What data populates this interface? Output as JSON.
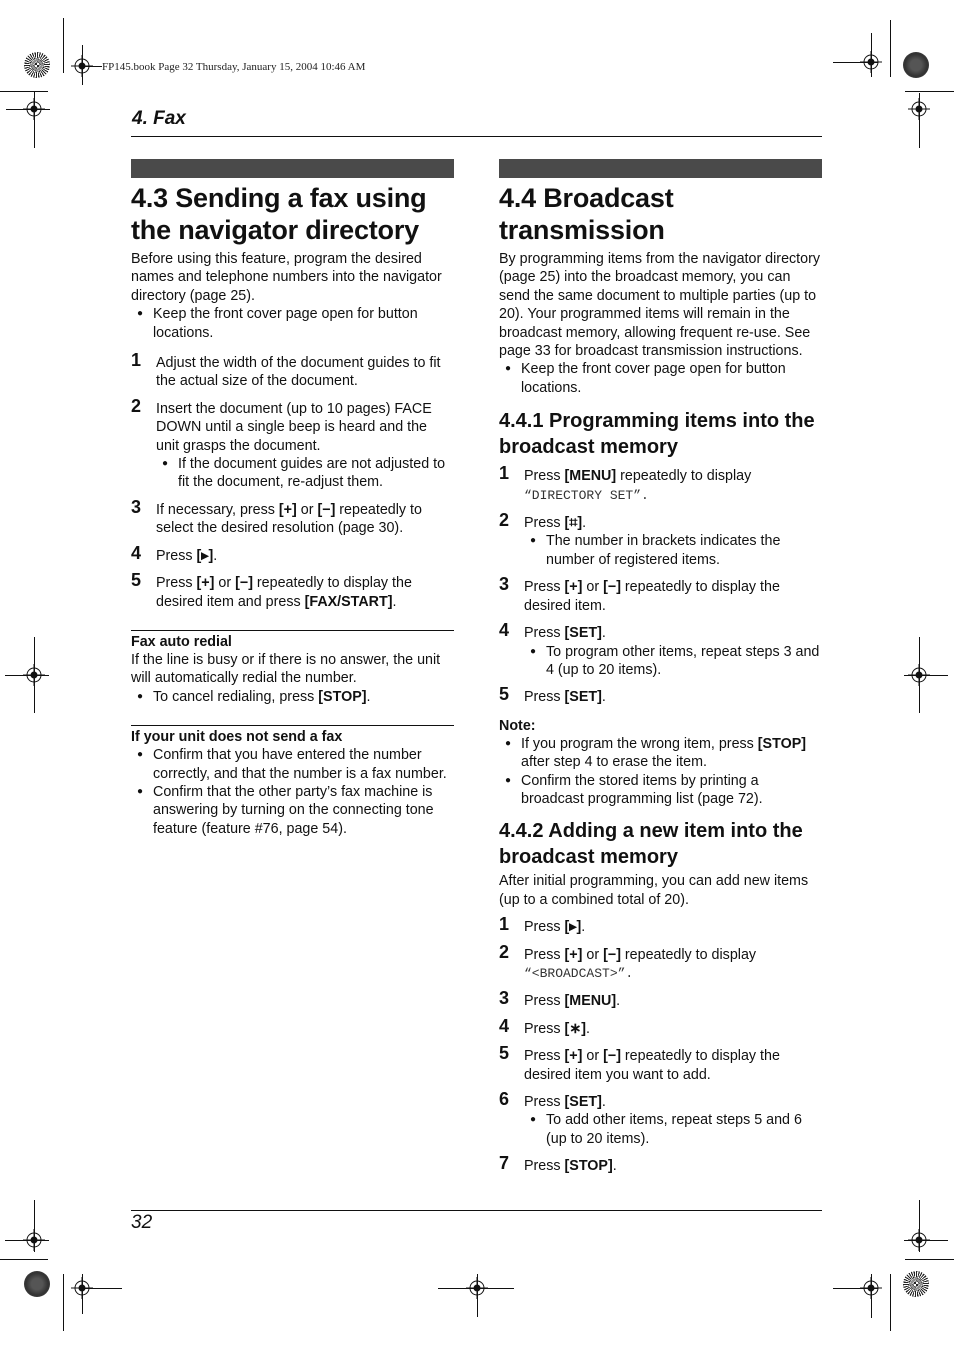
{
  "header": {
    "book_line": "FP145.book  Page 32  Thursday, January 15, 2004  10:46 AM",
    "chapter": "4. Fax"
  },
  "left": {
    "title": "4.3 Sending a fax using the navigator directory",
    "intro": "Before using this feature, program the desired names and telephone numbers into the navigator directory (page 25).",
    "intro_bullet": "Keep the front cover page open for button locations.",
    "steps": [
      {
        "num": "1",
        "text": "Adjust the width of the document guides to fit the actual size of the document."
      },
      {
        "num": "2",
        "text": "Insert the document (up to 10 pages) FACE DOWN until a single beep is heard and the unit grasps the document.",
        "bullet": "If the document guides are not adjusted to fit the document, re-adjust them."
      },
      {
        "num": "3",
        "pre": "If necessary, press ",
        "k1": "[+]",
        "mid": " or ",
        "k2": "[−]",
        "post": " repeatedly to select the desired resolution (page 30)."
      },
      {
        "num": "4",
        "pre": "Press ",
        "k1": "[▸]",
        "post": "."
      },
      {
        "num": "5",
        "pre": "Press ",
        "k1": "[+]",
        "mid": " or ",
        "k2": "[−]",
        "mid2": " repeatedly to display the desired item and press ",
        "k3": "[FAX/START]",
        "post": "."
      }
    ],
    "redial": {
      "heading": "Fax auto redial",
      "text": "If the line is busy or if there is no answer, the unit will automatically redial the number.",
      "bullet_pre": "To cancel redialing, press ",
      "bullet_key": "[STOP]",
      "bullet_post": "."
    },
    "nosend": {
      "heading": "If your unit does not send a fax",
      "bullets": [
        "Confirm that you have entered the number correctly, and that the number is a fax number.",
        "Confirm that the other party’s fax machine is answering by turning on the connecting tone feature (feature #76, page 54)."
      ]
    }
  },
  "right": {
    "title": "4.4 Broadcast transmission",
    "intro": "By programming items from the navigator directory (page 25) into the broadcast memory, you can send the same document to multiple parties (up to 20). Your programmed items will remain in the broadcast memory, allowing frequent re-use. See page 33 for broadcast transmission instructions.",
    "intro_bullet": "Keep the front cover page open for button locations.",
    "sec1": {
      "title": "4.4.1 Programming items into the broadcast memory",
      "s1_pre": "Press ",
      "s1_key": "[MENU]",
      "s1_post": " repeatedly to display",
      "s1_display": "“DIRECTORY SET”.",
      "s2_pre": "Press ",
      "s2_key": "[⌗]",
      "s2_post": ".",
      "s2_bullet": "The number in brackets indicates the number of registered items.",
      "s3_pre": "Press ",
      "s3_k1": "[+]",
      "s3_mid": " or ",
      "s3_k2": "[−]",
      "s3_post": " repeatedly to display the desired item.",
      "s4_pre": "Press ",
      "s4_key": "[SET]",
      "s4_post": ".",
      "s4_bullet": "To program other items, repeat steps 3 and 4 (up to 20 items).",
      "s5_pre": "Press ",
      "s5_key": "[SET]",
      "s5_post": ".",
      "note_label": "Note:",
      "note1_pre": "If you program the wrong item, press ",
      "note1_key": "[STOP]",
      "note1_post": " after step 4 to erase the item.",
      "note2": "Confirm the stored items by printing a broadcast programming list (page 72)."
    },
    "sec2": {
      "title": "4.4.2 Adding a new item into the broadcast memory",
      "intro": "After initial programming, you can add new items (up to a combined total of 20).",
      "s1_pre": "Press ",
      "s1_key": "[▸]",
      "s1_post": ".",
      "s2_pre": "Press ",
      "s2_k1": "[+]",
      "s2_mid": " or ",
      "s2_k2": "[−]",
      "s2_post": " repeatedly to display",
      "s2_display": "“<BROADCAST>”.",
      "s3_pre": "Press ",
      "s3_key": "[MENU]",
      "s3_post": ".",
      "s4_pre": "Press ",
      "s4_key": "[∗]",
      "s4_post": ".",
      "s5_pre": "Press ",
      "s5_k1": "[+]",
      "s5_mid": " or ",
      "s5_k2": "[−]",
      "s5_post": " repeatedly to display the desired item you want to add.",
      "s6_pre": "Press ",
      "s6_key": "[SET]",
      "s6_post": ".",
      "s6_bullet": "To add other items, repeat steps 5 and 6 (up to 20 items).",
      "s7_pre": "Press ",
      "s7_key": "[STOP]",
      "s7_post": "."
    }
  },
  "footer": {
    "page_number": "32"
  }
}
